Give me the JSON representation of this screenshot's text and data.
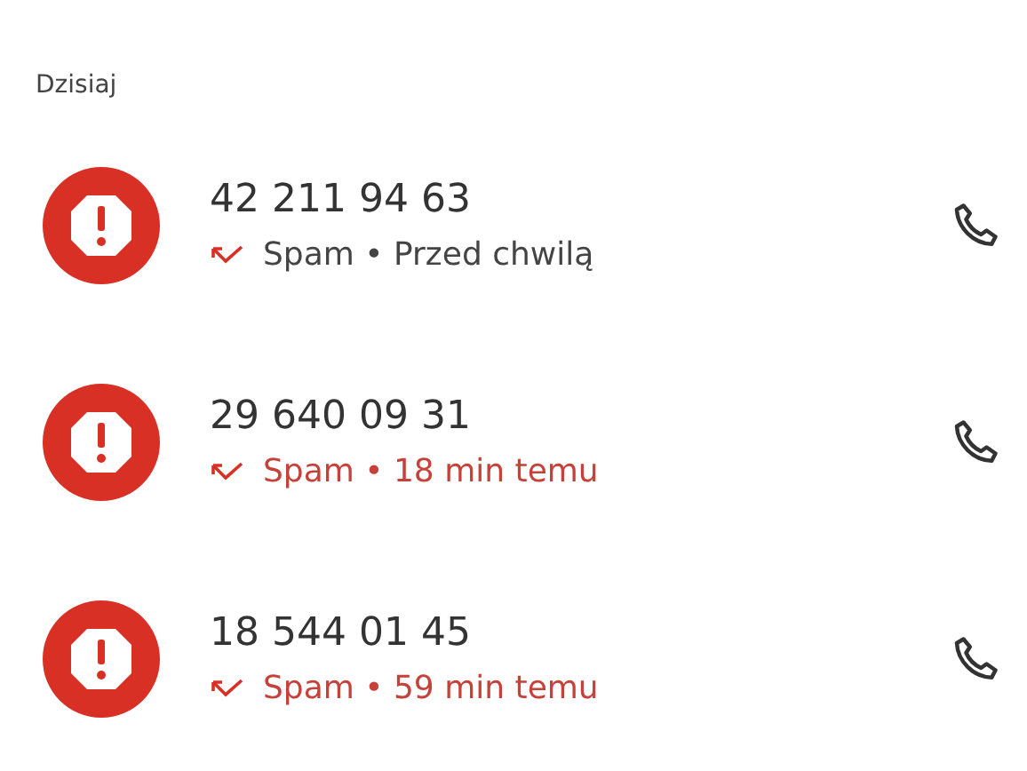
{
  "section": {
    "title": "Dzisiaj"
  },
  "calls": [
    {
      "number": "42 211 94 63",
      "details": "Spam • Przed chwilą",
      "unseen": false
    },
    {
      "number": "29 640 09 31",
      "details": "Spam • 18 min temu",
      "unseen": true
    },
    {
      "number": "18 544 01 45",
      "details": "Spam • 59 min temu",
      "unseen": true
    }
  ]
}
